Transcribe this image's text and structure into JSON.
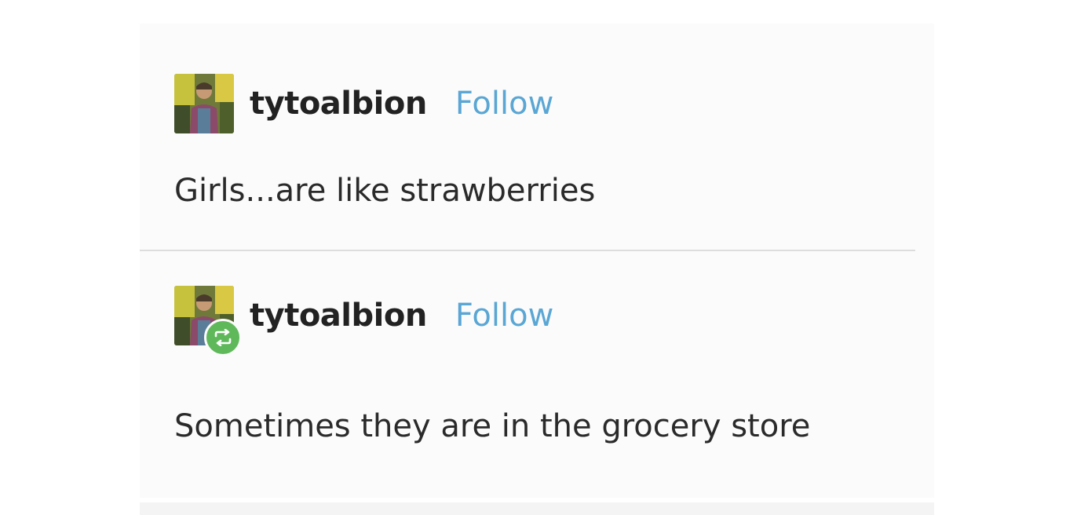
{
  "posts": [
    {
      "username": "tytoalbion",
      "follow_label": "Follow",
      "text": "Girls...are like strawberries",
      "reblog": false
    },
    {
      "username": "tytoalbion",
      "follow_label": "Follow",
      "text": "Sometimes they are in the grocery store",
      "reblog": true
    }
  ],
  "colors": {
    "follow_link": "#5aa6d4",
    "reblog_badge": "#5fb95a",
    "text": "#2a2a2a",
    "username": "#222222"
  },
  "icons": {
    "avatar": "avatar-photo",
    "reblog": "reblog-icon"
  }
}
